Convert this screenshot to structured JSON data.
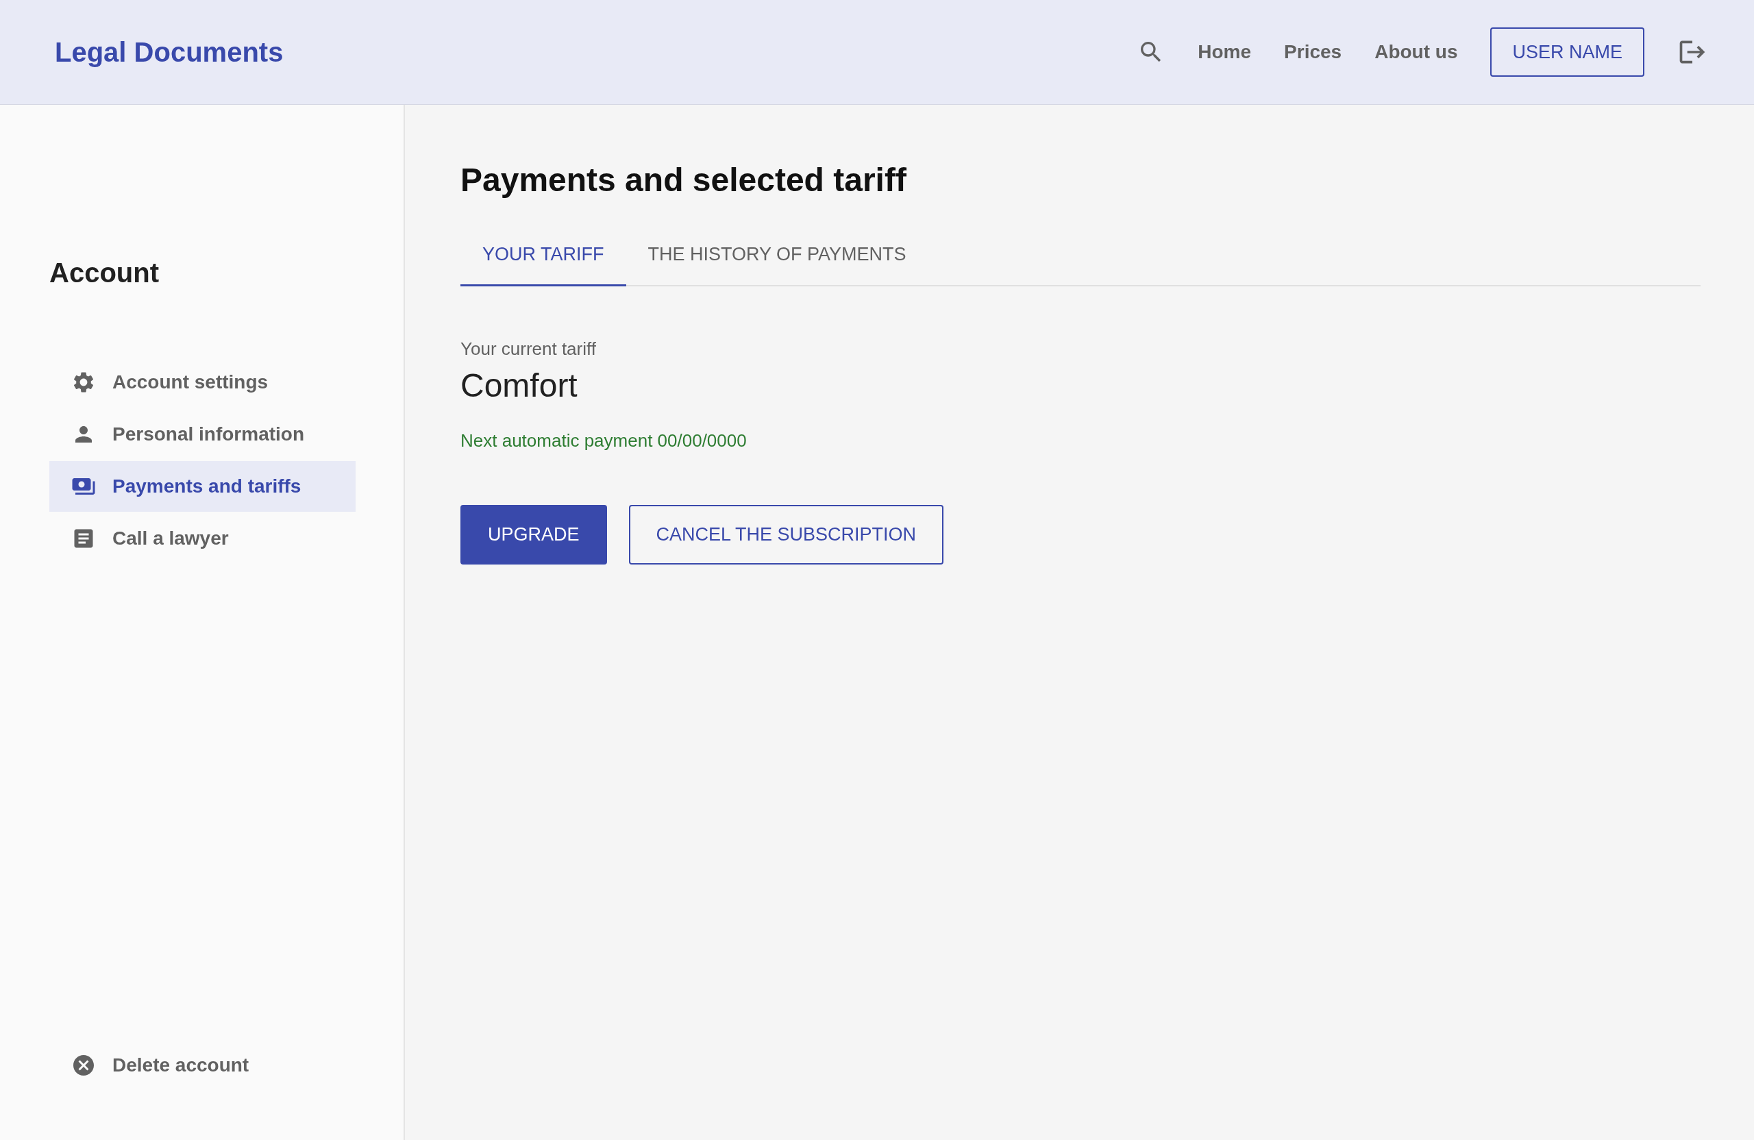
{
  "header": {
    "logo": "Legal Documents",
    "nav": [
      "Home",
      "Prices",
      "About us"
    ],
    "user_button": "USER NAME"
  },
  "sidebar": {
    "title": "Account",
    "items": [
      {
        "kind": "settings",
        "label": "Account settings",
        "selected": false
      },
      {
        "kind": "person",
        "label": "Personal information",
        "selected": false
      },
      {
        "kind": "payments",
        "label": "Payments and tariffs",
        "selected": true
      },
      {
        "kind": "document",
        "label": "Call a lawyer",
        "selected": false
      }
    ],
    "delete": "Delete account"
  },
  "main": {
    "title": "Payments and selected tariff",
    "tabs": [
      {
        "label": "YOUR TARIFF",
        "selected": true
      },
      {
        "label": "THE HISTORY OF PAYMENTS",
        "selected": false
      }
    ],
    "caption": "Your current tariff",
    "tariff": "Comfort",
    "next_payment": "Next automatic payment 00/00/0000",
    "buttons": [
      {
        "kind": "primary",
        "label": "UPGRADE"
      },
      {
        "kind": "outline",
        "label": "CANCEL THE SUBSCRIPTION"
      }
    ]
  }
}
